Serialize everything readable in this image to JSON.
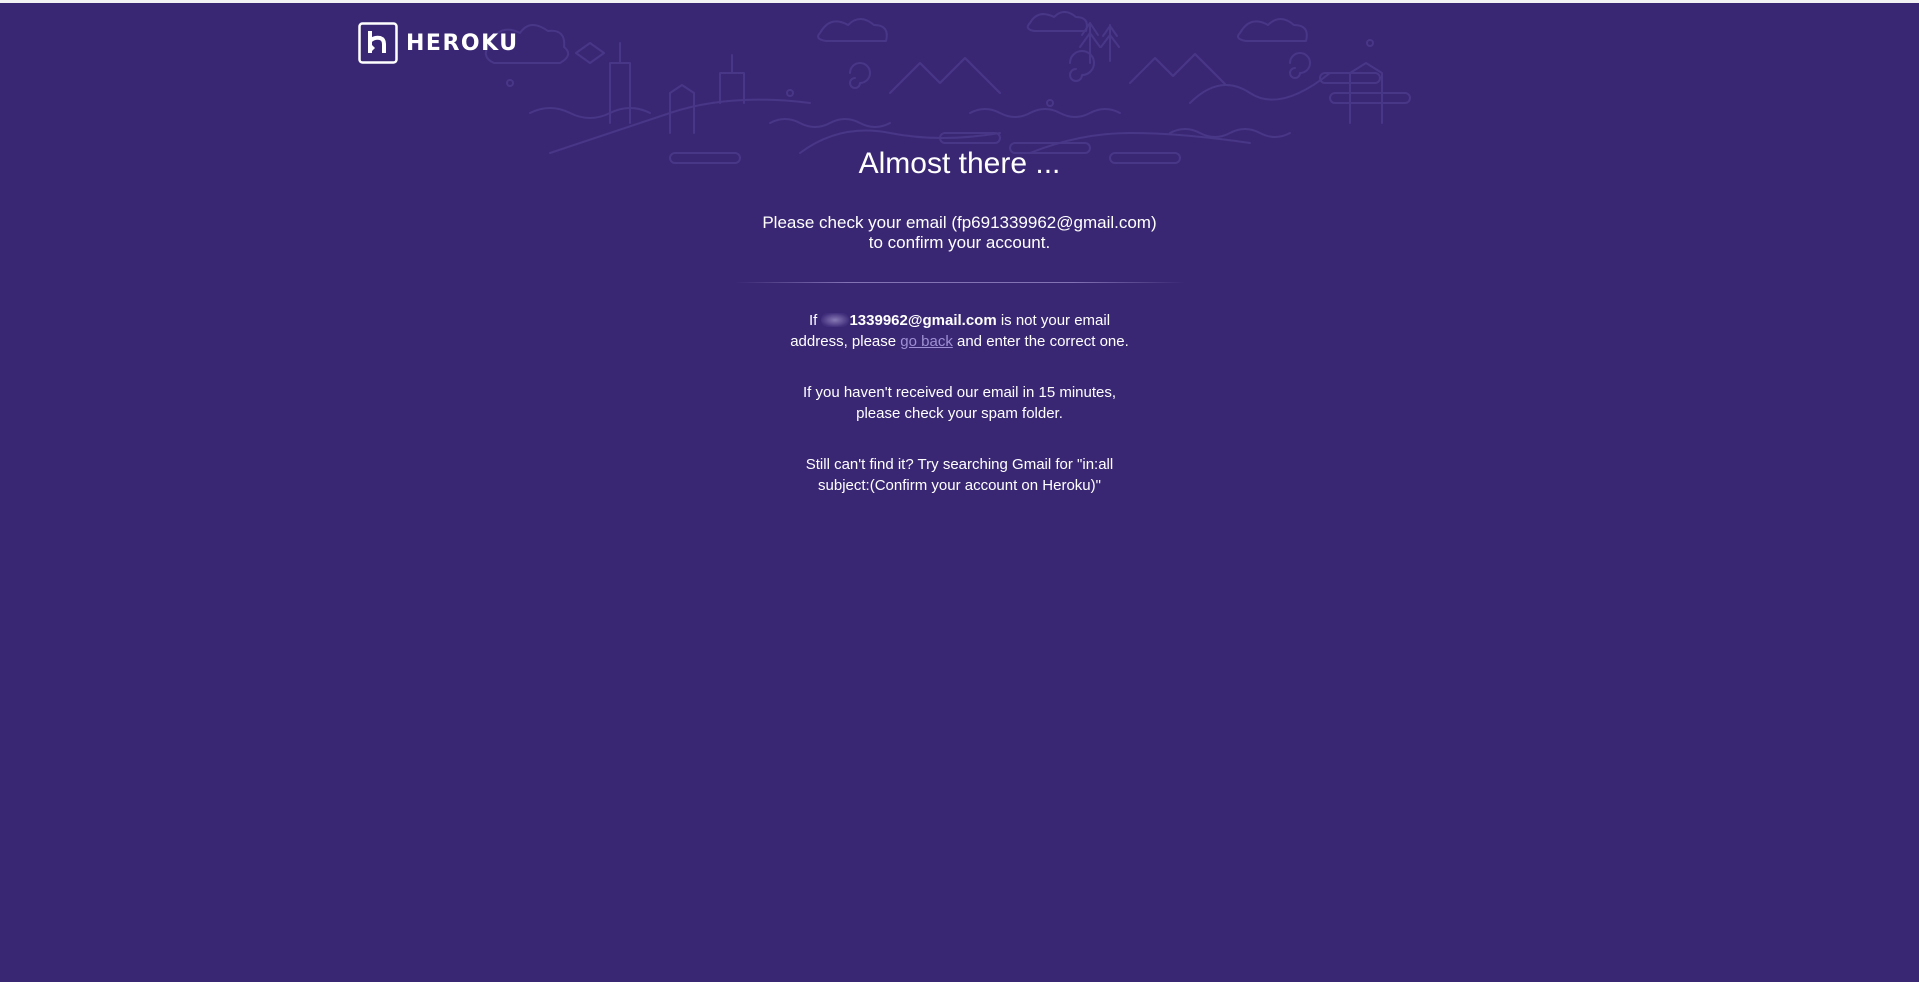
{
  "brand": {
    "name": "HEROKU",
    "icon": "heroku-logo-icon"
  },
  "heading": "Almost there ...",
  "check_email": {
    "line1": "Please check your email (fp691339962@gmail.com)",
    "line2": "to confirm your account."
  },
  "wrong_email": {
    "prefix": "If",
    "email_visible": "1339962@gmail.com",
    "middle": "is not your email",
    "line2_start": "address, please",
    "link": "go back",
    "line2_end": "and enter the correct one."
  },
  "spam_notice": {
    "line1": "If you haven't received our email in 15 minutes,",
    "line2": "please check your spam folder."
  },
  "search_hint": {
    "line1": "Still can't find it? Try searching Gmail for \"in:all",
    "line2": "subject:(Confirm your account on Heroku)\""
  },
  "colors": {
    "background": "#3a2774",
    "link": "#9e8fd4",
    "text": "#ffffff"
  }
}
